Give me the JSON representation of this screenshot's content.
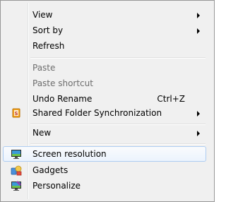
{
  "menu": {
    "items": [
      {
        "label": "View",
        "submenu": true,
        "disabled": false
      },
      {
        "label": "Sort by",
        "submenu": true,
        "disabled": false
      },
      {
        "label": "Refresh",
        "submenu": false,
        "disabled": false
      },
      {
        "label": "Paste",
        "submenu": false,
        "disabled": true
      },
      {
        "label": "Paste shortcut",
        "submenu": false,
        "disabled": true
      },
      {
        "label": "Undo Rename",
        "shortcut": "Ctrl+Z",
        "submenu": false,
        "disabled": false
      },
      {
        "label": "Shared Folder Synchronization",
        "submenu": true,
        "disabled": false,
        "icon": "sync-folder-icon"
      },
      {
        "label": "New",
        "submenu": true,
        "disabled": false
      },
      {
        "label": "Screen resolution",
        "submenu": false,
        "disabled": false,
        "highlighted": true,
        "icon": "monitor-icon"
      },
      {
        "label": "Gadgets",
        "submenu": false,
        "disabled": false,
        "icon": "gadgets-icon"
      },
      {
        "label": "Personalize",
        "submenu": false,
        "disabled": false,
        "icon": "personalize-icon"
      }
    ]
  },
  "colors": {
    "menu_bg": "#f0f0f0",
    "highlight_border": "#aeccf1",
    "disabled_text": "#6d6d6d"
  }
}
